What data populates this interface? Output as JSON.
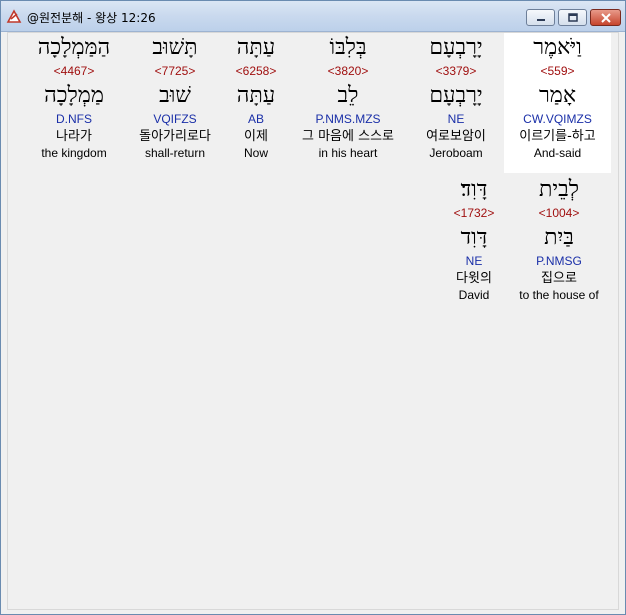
{
  "window": {
    "title": "@원전분해 - 왕상 12:26",
    "minimize_icon": "minimize-icon",
    "maximize_icon": "maximize-icon",
    "close_icon": "close-icon"
  },
  "colors": {
    "strong": "#a01010",
    "morph": "#1a2fa8",
    "titlebar": "#c9d9ee",
    "close_button": "#c6452d"
  },
  "words": [
    {
      "hebrew": "וַיֹּאמֶר",
      "strong": "<559>",
      "lemma": "אָמַר",
      "morph": "CW.VQIMZS",
      "korean": "이르기를-하고",
      "english": "And-said",
      "selected": true
    },
    {
      "hebrew": "יָרָבְעָם",
      "strong": "<3379>",
      "lemma": "יָרָבְעָם",
      "morph": "NE",
      "korean": "여로보암이",
      "english": "Jeroboam",
      "selected": false
    },
    {
      "hebrew": "בְּלִבּוֹ",
      "strong": "<3820>",
      "lemma": "לֵב",
      "morph": "P.NMS.MZS",
      "korean": "그 마음에 스스로",
      "english": "in his heart",
      "selected": false
    },
    {
      "hebrew": "עַתָּה",
      "strong": "<6258>",
      "lemma": "עַתָּה",
      "morph": "AB",
      "korean": "이제",
      "english": "Now",
      "selected": false
    },
    {
      "hebrew": "תָּשׁוּב",
      "strong": "<7725>",
      "lemma": "שׁוּב",
      "morph": "VQIFZS",
      "korean": "돌아가리로다",
      "english": "shall-return",
      "selected": false
    },
    {
      "hebrew": "הַמַּמְלָכָה",
      "strong": "<4467>",
      "lemma": "מַמְלָכָה",
      "morph": "D.NFS",
      "korean": "나라가",
      "english": "the kingdom",
      "selected": false
    },
    {
      "hebrew": "לְבֵית",
      "strong": "<1004>",
      "lemma": "בַּיִת",
      "morph": "P.NMSG",
      "korean": "집으로",
      "english": "to the house of",
      "selected": false
    },
    {
      "hebrew": "דָּוִד׃",
      "strong": "<1732>",
      "lemma": "דָּוִד",
      "morph": "NE",
      "korean": "다윗의",
      "english": "David",
      "selected": false
    }
  ]
}
